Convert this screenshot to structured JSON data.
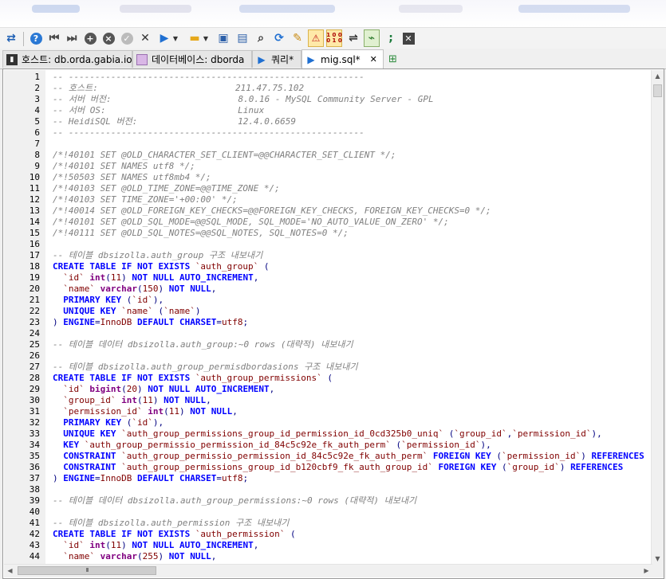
{
  "toolbar": {
    "icons": [
      "swap-icon",
      "help-icon",
      "first-icon",
      "last-icon",
      "add-icon",
      "stop-icon",
      "check-icon",
      "cancel-icon",
      "run-icon",
      "folder-icon",
      "save-icon",
      "search-icon",
      "replace-icon",
      "clear-icon",
      "warning-icon",
      "binary-icon",
      "wrap-icon",
      "format-icon",
      "semicolon-icon",
      "close-icon"
    ],
    "binary_label": "1 0 0\n0 1 0"
  },
  "tabs": [
    {
      "label": "호스트: db.orda.gabia.io",
      "icon": "host-icon"
    },
    {
      "label": "데이터베이스: dborda",
      "icon": "database-icon"
    },
    {
      "label": "쿼리*",
      "icon": "query-icon"
    },
    {
      "label": "mig.sql*",
      "icon": "query-icon",
      "active": true,
      "close": "✕"
    }
  ],
  "add_tab_icon": "new-tab-icon",
  "editor": {
    "lines": [
      {
        "n": "1",
        "html": "<span class=\"c\">-- --------------------------------------------------------</span>"
      },
      {
        "n": "2",
        "html": "<span class=\"c\">-- 호스트:                          211.47.75.102</span>"
      },
      {
        "n": "3",
        "html": "<span class=\"c\">-- 서버 버전:                        8.0.16 - MySQL Community Server - GPL</span>"
      },
      {
        "n": "4",
        "html": "<span class=\"c\">-- 서버 OS:                         Linux</span>"
      },
      {
        "n": "5",
        "html": "<span class=\"c\">-- HeidiSQL 버전:                   12.4.0.6659</span>"
      },
      {
        "n": "6",
        "html": "<span class=\"c\">-- --------------------------------------------------------</span>"
      },
      {
        "n": "7",
        "html": ""
      },
      {
        "n": "8",
        "html": "<span class=\"c\">/*!40101 SET @OLD_CHARACTER_SET_CLIENT=@@CHARACTER_SET_CLIENT */;</span>"
      },
      {
        "n": "9",
        "html": "<span class=\"c\">/*!40101 SET NAMES utf8 */;</span>"
      },
      {
        "n": "10",
        "html": "<span class=\"c\">/*!50503 SET NAMES utf8mb4 */;</span>"
      },
      {
        "n": "11",
        "html": "<span class=\"c\">/*!40103 SET @OLD_TIME_ZONE=@@TIME_ZONE */;</span>"
      },
      {
        "n": "12",
        "html": "<span class=\"c\">/*!40103 SET TIME_ZONE='+00:00' */;</span>"
      },
      {
        "n": "13",
        "html": "<span class=\"c\">/*!40014 SET @OLD_FOREIGN_KEY_CHECKS=@@FOREIGN_KEY_CHECKS, FOREIGN_KEY_CHECKS=0 */;</span>"
      },
      {
        "n": "14",
        "html": "<span class=\"c\">/*!40101 SET @OLD_SQL_MODE=@@SQL_MODE, SQL_MODE='NO_AUTO_VALUE_ON_ZERO' */;</span>"
      },
      {
        "n": "15",
        "html": "<span class=\"c\">/*!40111 SET @OLD_SQL_NOTES=@@SQL_NOTES, SQL_NOTES=0 */;</span>"
      },
      {
        "n": "16",
        "html": ""
      },
      {
        "n": "17",
        "html": "<span class=\"c\">-- 테이블 dbsizolla.auth_group 구조 내보내기</span>"
      },
      {
        "n": "18",
        "html": "<span class=\"k\">CREATE TABLE IF NOT EXISTS</span> <span class=\"n\">`auth_group`</span> <span class=\"p\">(</span>"
      },
      {
        "n": "19",
        "html": "  <span class=\"n\">`id`</span> <span class=\"t\">int</span><span class=\"p\">(</span><span class=\"n\">11</span><span class=\"p\">)</span> <span class=\"k\">NOT NULL AUTO_INCREMENT</span><span class=\"p\">,</span>"
      },
      {
        "n": "20",
        "html": "  <span class=\"n\">`name`</span> <span class=\"t\">varchar</span><span class=\"p\">(</span><span class=\"n\">150</span><span class=\"p\">)</span> <span class=\"k\">NOT NULL</span><span class=\"p\">,</span>"
      },
      {
        "n": "21",
        "html": "  <span class=\"k\">PRIMARY KEY</span> <span class=\"p\">(</span><span class=\"n\">`id`</span><span class=\"p\">),</span>"
      },
      {
        "n": "22",
        "html": "  <span class=\"k\">UNIQUE KEY</span> <span class=\"n\">`name`</span> <span class=\"p\">(</span><span class=\"n\">`name`</span><span class=\"p\">)</span>"
      },
      {
        "n": "23",
        "html": "<span class=\"p\">)</span> <span class=\"k\">ENGINE</span><span class=\"p\">=</span><span class=\"n\">InnoDB</span> <span class=\"k\">DEFAULT CHARSET</span><span class=\"p\">=</span><span class=\"n\">utf8</span><span class=\"p\">;</span>"
      },
      {
        "n": "24",
        "html": ""
      },
      {
        "n": "25",
        "html": "<span class=\"c\">-- 테이블 데이터 dbsizolla.auth_group:~0 rows (대략적) 내보내기</span>"
      },
      {
        "n": "26",
        "html": ""
      },
      {
        "n": "27",
        "html": "<span class=\"c\">-- 테이블 dbsizolla.auth_group_permisdbordasions 구조 내보내기</span>"
      },
      {
        "n": "28",
        "html": "<span class=\"k\">CREATE TABLE IF NOT EXISTS</span> <span class=\"n\">`auth_group_permissions`</span> <span class=\"p\">(</span>"
      },
      {
        "n": "29",
        "html": "  <span class=\"n\">`id`</span> <span class=\"t\">bigint</span><span class=\"p\">(</span><span class=\"n\">20</span><span class=\"p\">)</span> <span class=\"k\">NOT NULL AUTO_INCREMENT</span><span class=\"p\">,</span>"
      },
      {
        "n": "30",
        "html": "  <span class=\"n\">`group_id`</span> <span class=\"t\">int</span><span class=\"p\">(</span><span class=\"n\">11</span><span class=\"p\">)</span> <span class=\"k\">NOT NULL</span><span class=\"p\">,</span>"
      },
      {
        "n": "31",
        "html": "  <span class=\"n\">`permission_id`</span> <span class=\"t\">int</span><span class=\"p\">(</span><span class=\"n\">11</span><span class=\"p\">)</span> <span class=\"k\">NOT NULL</span><span class=\"p\">,</span>"
      },
      {
        "n": "32",
        "html": "  <span class=\"k\">PRIMARY KEY</span> <span class=\"p\">(</span><span class=\"n\">`id`</span><span class=\"p\">),</span>"
      },
      {
        "n": "33",
        "html": "  <span class=\"k\">UNIQUE KEY</span> <span class=\"n\">`auth_group_permissions_group_id_permission_id_0cd325b0_uniq`</span> <span class=\"p\">(</span><span class=\"n\">`group_id`</span><span class=\"p\">,</span><span class=\"n\">`permission_id`</span><span class=\"p\">),</span>"
      },
      {
        "n": "34",
        "html": "  <span class=\"k\">KEY</span> <span class=\"n\">`auth_group_permissio_permission_id_84c5c92e_fk_auth_perm`</span> <span class=\"p\">(</span><span class=\"n\">`permission_id`</span><span class=\"p\">),</span>"
      },
      {
        "n": "35",
        "html": "  <span class=\"k\">CONSTRAINT</span> <span class=\"n\">`auth_group_permissio_permission_id_84c5c92e_fk_auth_perm`</span> <span class=\"k\">FOREIGN KEY</span> <span class=\"p\">(</span><span class=\"n\">`permission_id`</span><span class=\"p\">)</span> <span class=\"k\">REFERENCES</span>"
      },
      {
        "n": "36",
        "html": "  <span class=\"k\">CONSTRAINT</span> <span class=\"n\">`auth_group_permissions_group_id_b120cbf9_fk_auth_group_id`</span> <span class=\"k\">FOREIGN KEY</span> <span class=\"p\">(</span><span class=\"n\">`group_id`</span><span class=\"p\">)</span> <span class=\"k\">REFERENCES</span>"
      },
      {
        "n": "37",
        "html": "<span class=\"p\">)</span> <span class=\"k\">ENGINE</span><span class=\"p\">=</span><span class=\"n\">InnoDB</span> <span class=\"k\">DEFAULT CHARSET</span><span class=\"p\">=</span><span class=\"n\">utf8</span><span class=\"p\">;</span>"
      },
      {
        "n": "38",
        "html": ""
      },
      {
        "n": "39",
        "html": "<span class=\"c\">-- 테이블 데이터 dbsizolla.auth_group_permissions:~0 rows (대략적) 내보내기</span>"
      },
      {
        "n": "40",
        "html": ""
      },
      {
        "n": "41",
        "html": "<span class=\"c\">-- 테이블 dbsizolla.auth_permission 구조 내보내기</span>"
      },
      {
        "n": "42",
        "html": "<span class=\"k\">CREATE TABLE IF NOT EXISTS</span> <span class=\"n\">`auth_permission`</span> <span class=\"p\">(</span>"
      },
      {
        "n": "43",
        "html": "  <span class=\"n\">`id`</span> <span class=\"t\">int</span><span class=\"p\">(</span><span class=\"n\">11</span><span class=\"p\">)</span> <span class=\"k\">NOT NULL AUTO_INCREMENT</span><span class=\"p\">,</span>"
      },
      {
        "n": "44",
        "html": "  <span class=\"n\">`name`</span> <span class=\"t\">varchar</span><span class=\"p\">(</span><span class=\"n\">255</span><span class=\"p\">)</span> <span class=\"k\">NOT NULL</span><span class=\"p\">,</span>"
      }
    ]
  },
  "scroll": {
    "up": "▲",
    "down": "▼",
    "left": "◀",
    "right": "▶",
    "grip": "III"
  }
}
